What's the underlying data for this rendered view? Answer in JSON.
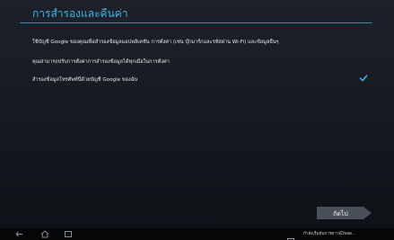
{
  "header": {
    "title": "การสำรองและคืนค่า"
  },
  "content": {
    "line1": "ใช้บัญชี Google ของคุณเพื่อสำรองข้อมูลแอปพลิเคชัน การตั้งค่า (เช่น บุ๊กมาร์กและรหัสผ่าน Wi-Fi) และข้อมูลอื่นๆ",
    "line2": "คุณสามารถปรับการตั้งค่าการสำรองข้อมูลได้ทุกเมื่อในการตั้งค่า",
    "backup_option_label": "สำรองข้อมูลโทรศัพท์นี้ด้วยบัญชี Google ของฉัน",
    "backup_checked": true
  },
  "footer": {
    "next_label": "ถัดไป"
  },
  "navbar": {
    "notification_text": "กำลังเริ่มต้นการดาวน์โหลด..."
  },
  "colors": {
    "accent": "#3fb3e4",
    "background": "#1b1f27"
  }
}
